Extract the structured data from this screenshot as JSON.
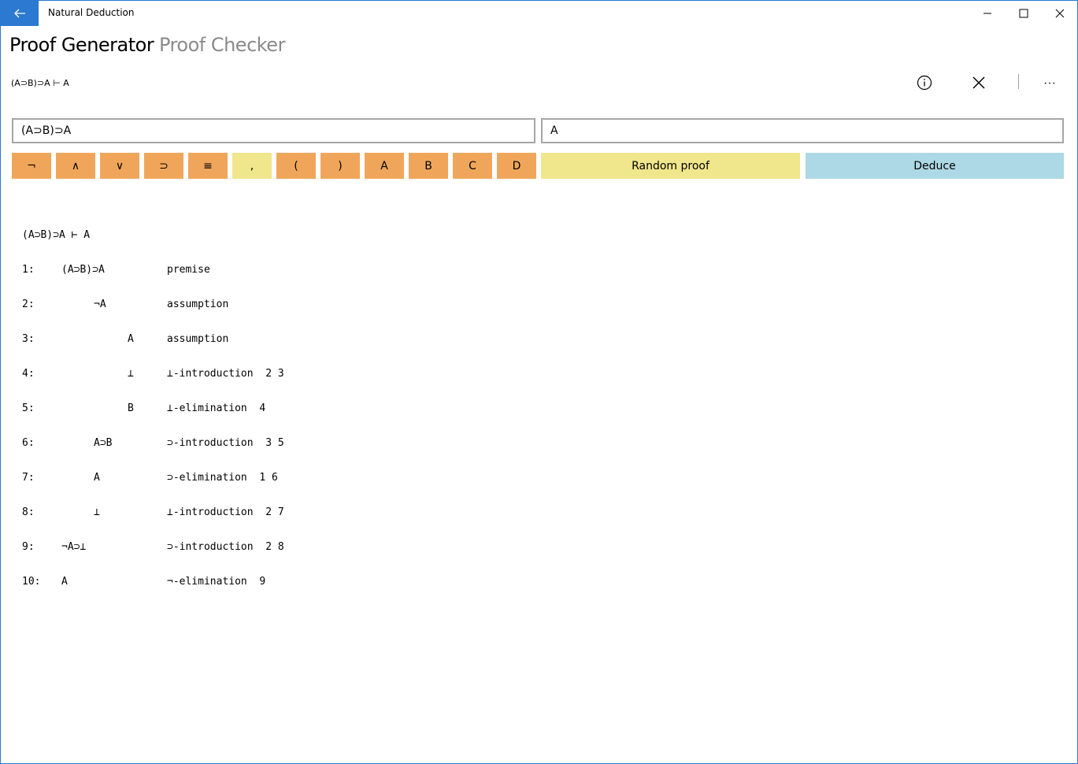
{
  "window": {
    "title": "Natural Deduction"
  },
  "tabs": [
    {
      "label": "Proof Generator",
      "active": true
    },
    {
      "label": "Proof Checker",
      "active": false
    }
  ],
  "command_bar": {
    "sequent": "(A⊃B)⊃A ⊢ A",
    "more_glyph": "···"
  },
  "inputs": {
    "premises_value": "(A⊃B)⊃A",
    "conclusion_value": "A"
  },
  "symbols": [
    "¬",
    "∧",
    "∨",
    "⊃",
    "≡",
    ",",
    "(",
    ")",
    "A",
    "B",
    "C",
    "D"
  ],
  "buttons": {
    "random_proof": "Random proof",
    "deduce": "Deduce"
  },
  "colors": {
    "accent": "#2b79d0",
    "symbol_button": "#f0a65a",
    "comma_button": "#f0e68c",
    "random_button": "#f0e68c",
    "deduce_button": "#add8e6",
    "inactive_tab": "#8a8a8a"
  },
  "proof": {
    "title": "(A⊃B)⊃A ⊢ A",
    "lines": [
      {
        "num": "1:",
        "depth": 0,
        "formula": "(A⊃B)⊃A",
        "rule": "premise"
      },
      {
        "num": "2:",
        "depth": 1,
        "formula": "¬A",
        "rule": "assumption"
      },
      {
        "num": "3:",
        "depth": 2,
        "formula": "A",
        "rule": "assumption"
      },
      {
        "num": "4:",
        "depth": 2,
        "formula": "⊥",
        "rule": "⊥-introduction  2 3"
      },
      {
        "num": "5:",
        "depth": 2,
        "formula": "B",
        "rule": "⊥-elimination  4"
      },
      {
        "num": "6:",
        "depth": 1,
        "formula": "A⊃B",
        "rule": "⊃-introduction  3 5"
      },
      {
        "num": "7:",
        "depth": 1,
        "formula": "A",
        "rule": "⊃-elimination  1 6"
      },
      {
        "num": "8:",
        "depth": 1,
        "formula": "⊥",
        "rule": "⊥-introduction  2 7"
      },
      {
        "num": "9:",
        "depth": 0,
        "formula": "¬A⊃⊥",
        "rule": "⊃-introduction  2 8"
      },
      {
        "num": "10:",
        "depth": 0,
        "formula": "A",
        "rule": "¬-elimination  9"
      }
    ]
  }
}
